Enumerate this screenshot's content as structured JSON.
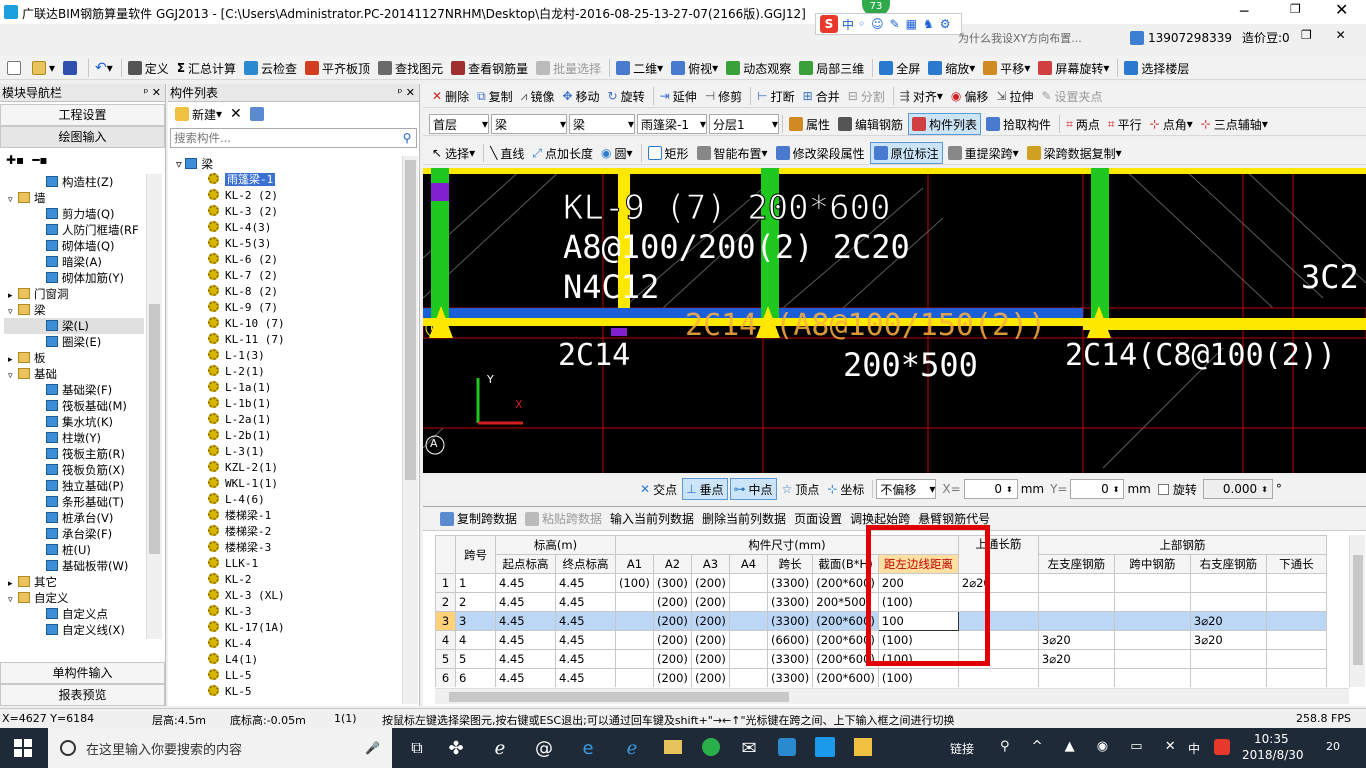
{
  "window": {
    "title": "广联达BIM钢筋算量软件 GGJ2013 - [C:\\Users\\Administrator.PC-20141127NRHM\\Desktop\\白龙村-2016-08-25-13-27-07(2166版).GGJ12]",
    "badge": "73",
    "ime": "中",
    "ad_text": "为什么我设XY方向布置...",
    "phone": "13907298339",
    "beans": "造价豆:0"
  },
  "toolbar1": [
    "定义",
    "汇总计算",
    "云检查",
    "平齐板顶",
    "查找图元",
    "查看钢筋量",
    "批量选择",
    "二维",
    "俯视",
    "动态观察",
    "局部三维",
    "全屏",
    "缩放",
    "平移",
    "屏幕旋转",
    "选择楼层"
  ],
  "toolbar2": [
    "删除",
    "复制",
    "镜像",
    "移动",
    "旋转",
    "延伸",
    "修剪",
    "打断",
    "合并",
    "分割",
    "对齐",
    "偏移",
    "拉伸",
    "设置夹点"
  ],
  "toolbar3": {
    "floor": "首层",
    "type1": "梁",
    "type2": "梁",
    "component": "雨篷梁-1",
    "layer": "分层1",
    "items": [
      "属性",
      "编辑钢筋",
      "构件列表",
      "拾取构件",
      "两点",
      "平行",
      "点角",
      "三点辅轴"
    ]
  },
  "toolbar4": [
    "选择",
    "直线",
    "点加长度",
    "圆",
    "矩形",
    "智能布置",
    "修改梁段属性",
    "原位标注",
    "重提梁跨",
    "梁跨数据复制"
  ],
  "nav_panel": {
    "title": "模块导航栏",
    "btn_project": "工程设置",
    "btn_draw": "绘图输入",
    "tree": [
      {
        "label": "构造柱(Z)",
        "level": 2,
        "kind": "comp"
      },
      {
        "label": "墙",
        "level": 0,
        "kind": "folder"
      },
      {
        "label": "剪力墙(Q)",
        "level": 2,
        "kind": "comp"
      },
      {
        "label": "人防门框墙(RF",
        "level": 2,
        "kind": "comp"
      },
      {
        "label": "砌体墙(Q)",
        "level": 2,
        "kind": "comp"
      },
      {
        "label": "暗梁(A)",
        "level": 2,
        "kind": "comp"
      },
      {
        "label": "砌体加筋(Y)",
        "level": 2,
        "kind": "comp"
      },
      {
        "label": "门窗洞",
        "level": 0,
        "kind": "folder"
      },
      {
        "label": "梁",
        "level": 0,
        "kind": "folder"
      },
      {
        "label": "梁(L)",
        "level": 2,
        "kind": "comp"
      },
      {
        "label": "圈梁(E)",
        "level": 2,
        "kind": "comp"
      },
      {
        "label": "板",
        "level": 0,
        "kind": "folder"
      },
      {
        "label": "基础",
        "level": 0,
        "kind": "folder"
      },
      {
        "label": "基础梁(F)",
        "level": 2,
        "kind": "comp"
      },
      {
        "label": "筏板基础(M)",
        "level": 2,
        "kind": "comp"
      },
      {
        "label": "集水坑(K)",
        "level": 2,
        "kind": "comp"
      },
      {
        "label": "柱墩(Y)",
        "level": 2,
        "kind": "comp"
      },
      {
        "label": "筏板主筋(R)",
        "level": 2,
        "kind": "comp"
      },
      {
        "label": "筏板负筋(X)",
        "level": 2,
        "kind": "comp"
      },
      {
        "label": "独立基础(P)",
        "level": 2,
        "kind": "comp"
      },
      {
        "label": "条形基础(T)",
        "level": 2,
        "kind": "comp"
      },
      {
        "label": "桩承台(V)",
        "level": 2,
        "kind": "comp"
      },
      {
        "label": "承台梁(F)",
        "level": 2,
        "kind": "comp"
      },
      {
        "label": "桩(U)",
        "level": 2,
        "kind": "comp"
      },
      {
        "label": "基础板带(W)",
        "level": 2,
        "kind": "comp"
      },
      {
        "label": "其它",
        "level": 0,
        "kind": "folder"
      },
      {
        "label": "自定义",
        "level": 0,
        "kind": "folder"
      },
      {
        "label": "自定义点",
        "level": 2,
        "kind": "comp"
      },
      {
        "label": "自定义线(X)",
        "level": 2,
        "kind": "comp"
      }
    ],
    "btn_single": "单构件输入",
    "btn_report": "报表预览"
  },
  "comp_panel": {
    "title": "构件列表",
    "new_label": "新建",
    "search_placeholder": "搜索构件...",
    "root": "梁",
    "items": [
      "雨篷梁-1",
      "KL-2 (2)",
      "KL-3 (2)",
      "KL-4(3)",
      "KL-5(3)",
      "KL-6 (2)",
      "KL-7 (2)",
      "KL-8 (2)",
      "KL-9 (7)",
      "KL-10 (7)",
      "KL-11 (7)",
      "L-1(3)",
      "L-2(1)",
      "L-1a(1)",
      "L-1b(1)",
      "L-2a(1)",
      "L-2b(1)",
      "L-3(1)",
      "KZL-2(1)",
      "WKL-1(1)",
      "L-4(6)",
      "楼梯梁-1",
      "楼梯梁-2",
      "楼梯梁-3",
      "LLK-1",
      "KL-2",
      "XL-3 (XL)",
      "KL-3",
      "KL-17(1A)",
      "KL-4",
      "L4(1)",
      "LL-5",
      "KL-5"
    ]
  },
  "cad": {
    "label_kl9": "KL-9 (7)  200*600",
    "label_rebar": "A8@100/200(2) 2C20",
    "label_n": "N4C12",
    "label_2c14_mid": "2C14 (A8@100/150(2))",
    "label_2c14_left": "2C14",
    "label_200x500": "200*500",
    "label_2c14_right": "2C14(C8@100(2))",
    "label_3c2": "3C2",
    "axis_b": "B",
    "axis_a": "A",
    "axis_y": "Y",
    "axis_x": "X"
  },
  "snapbar": {
    "items": [
      "交点",
      "垂点",
      "中点",
      "顶点",
      "坐标"
    ],
    "offset": "不偏移",
    "x_label": "X=",
    "x_value": "0",
    "mm1": "mm",
    "y_label": "Y=",
    "y_value": "0",
    "mm2": "mm",
    "rotate": "旋转",
    "rotate_value": "0.000",
    "deg": "°"
  },
  "table_toolbar": [
    "复制跨数据",
    "粘贴跨数据",
    "输入当前列数据",
    "删除当前列数据",
    "页面设置",
    "调换起始跨",
    "悬臂钢筋代号"
  ],
  "table": {
    "group_headers": {
      "span": "跨号",
      "elev": "标高(m)",
      "size": "构件尺寸(mm)",
      "top_long": "上通长筋",
      "top_rebar": "上部钢筋"
    },
    "headers": [
      "起点标高",
      "终点标高",
      "A1",
      "A2",
      "A3",
      "A4",
      "跨长",
      "截面(B*H)",
      "距左边线距离",
      "左支座钢筋",
      "跨中钢筋",
      "右支座钢筋",
      "下通长"
    ],
    "rows": [
      [
        "1",
        "1",
        "4.45",
        "4.45",
        "(100)",
        "(300)",
        "(200)",
        "",
        "(3300)",
        "(200*600)",
        "200",
        "2⌀20",
        "",
        "",
        "",
        ""
      ],
      [
        "2",
        "2",
        "4.45",
        "4.45",
        "",
        "(200)",
        "(200)",
        "",
        "(3300)",
        "200*500",
        "(100)",
        "",
        "",
        "",
        "",
        ""
      ],
      [
        "3",
        "3",
        "4.45",
        "4.45",
        "",
        "(200)",
        "(200)",
        "",
        "(3300)",
        "(200*600)",
        "100",
        "",
        "",
        "",
        "3⌀20",
        ""
      ],
      [
        "4",
        "4",
        "4.45",
        "4.45",
        "",
        "(200)",
        "(200)",
        "",
        "(6600)",
        "(200*600)",
        "(100)",
        "",
        "3⌀20",
        "",
        "3⌀20",
        ""
      ],
      [
        "5",
        "5",
        "4.45",
        "4.45",
        "",
        "(200)",
        "(200)",
        "",
        "(3300)",
        "(200*600)",
        "(100)",
        "",
        "3⌀20",
        "",
        "",
        ""
      ],
      [
        "6",
        "6",
        "4.45",
        "4.45",
        "",
        "(200)",
        "(200)",
        "",
        "(3300)",
        "(200*600)",
        "(100)",
        "",
        "",
        "",
        "",
        ""
      ]
    ]
  },
  "status": {
    "coords": "X=4627 Y=6184",
    "floor_h": "层高:4.5m",
    "bottom_elev": "底标高:-0.05m",
    "count": "1(1)",
    "hint": "按鼠标左键选择梁图元,按右键或ESC退出;可以通过回车键及shift+\"→←↑\"光标键在跨之间、上下输入框之间进行切换",
    "fps": "258.8 FPS"
  },
  "taskbar": {
    "search_placeholder": "在这里输入你要搜索的内容",
    "link": "链接",
    "ime": "中",
    "time": "10:35",
    "date": "2018/8/30",
    "notif": "20"
  },
  "colors": {
    "accent_red": "#e00000",
    "yellow": "#ffe800",
    "green": "#1ec81e",
    "blue": "#1a5fd8",
    "magenta": "#c020c0"
  }
}
